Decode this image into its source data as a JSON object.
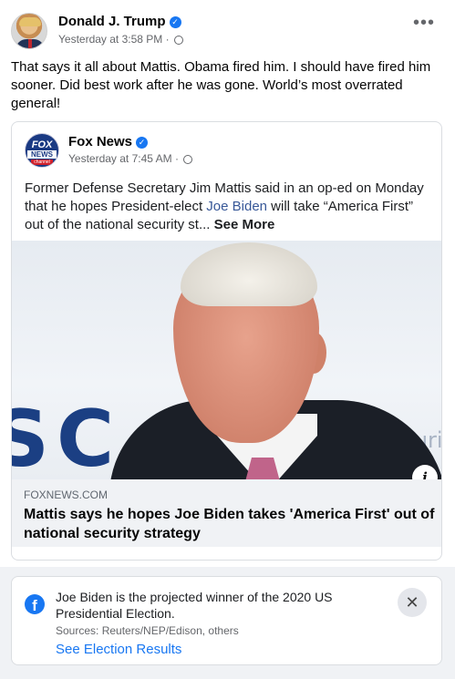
{
  "post": {
    "author": "Donald J. Trump",
    "timestamp": "Yesterday at 3:58 PM",
    "privacy_icon": "globe-icon",
    "more_label": "•••",
    "text": "That says it all about Mattis. Obama fired him. I should have fired him sooner. Did best work after he was gone. World’s most overrated general!"
  },
  "shared": {
    "page_name": "Fox News",
    "logo_text_1": "FOX",
    "logo_text_2": "NEWS",
    "logo_text_3": "channel",
    "timestamp": "Yesterday at 7:45 AM",
    "text_before": "Former Defense Secretary Jim Mattis said in an op-ed on Monday that he hopes President-elect ",
    "link_name": "Joe Biden",
    "text_after": " will take “America First” out of the national security st...",
    "see_more": " See More",
    "image_text_left": "SC",
    "image_text_right": "curit",
    "info_label": "i"
  },
  "link_preview": {
    "domain": "FOXNEWS.COM",
    "title": "Mattis says he hopes Joe Biden takes 'America First' out of national security strategy"
  },
  "notice": {
    "text": "Joe Biden is the projected winner of the 2020 US Presidential Election.",
    "sources": "Sources: Reuters/NEP/Edison, others",
    "link": "See Election Results",
    "icon_letter": "f",
    "close_label": "✕"
  },
  "colors": {
    "accent": "#1877f2",
    "link": "#385898",
    "muted": "#65676b"
  }
}
